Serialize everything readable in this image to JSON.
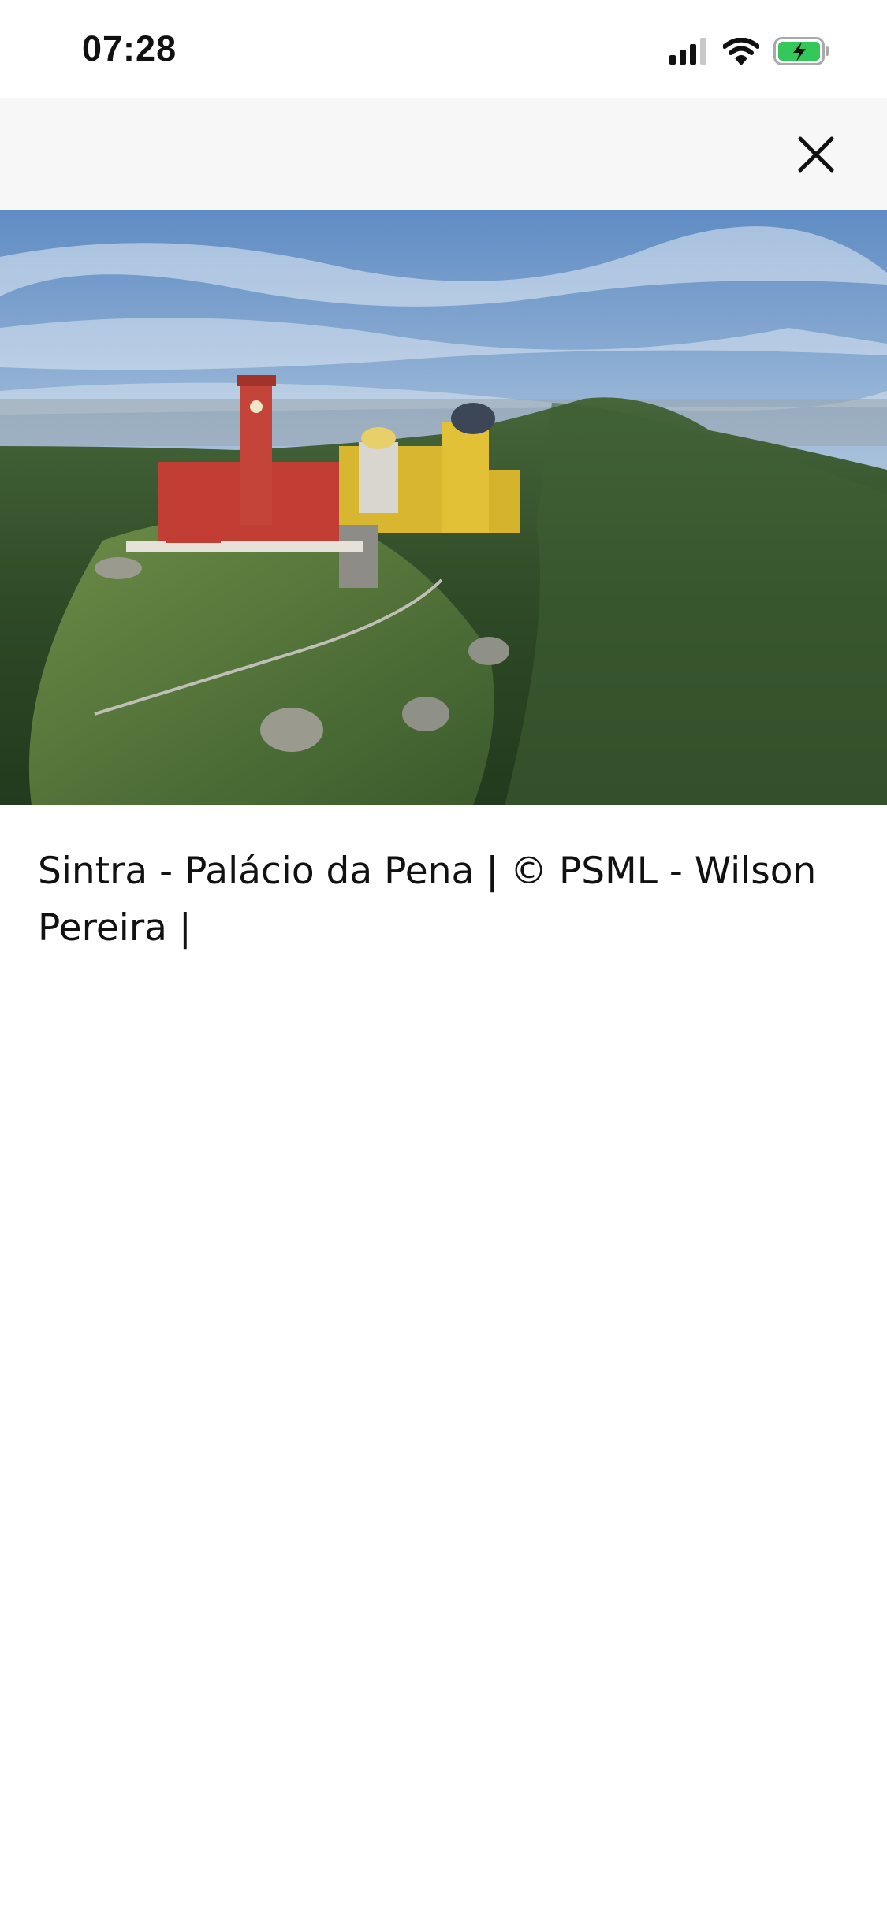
{
  "status_bar": {
    "time": "07:28",
    "icons": [
      "cellular-signal-icon",
      "wifi-icon",
      "battery-charging-icon"
    ],
    "battery_color": "#34c759"
  },
  "nav": {
    "close_icon": "close-icon"
  },
  "photo": {
    "alt": "Sintra - Palácio da Pena"
  },
  "caption": {
    "text": "Sintra - Palácio da Pena | © PSML - Wilson Pereira |"
  }
}
